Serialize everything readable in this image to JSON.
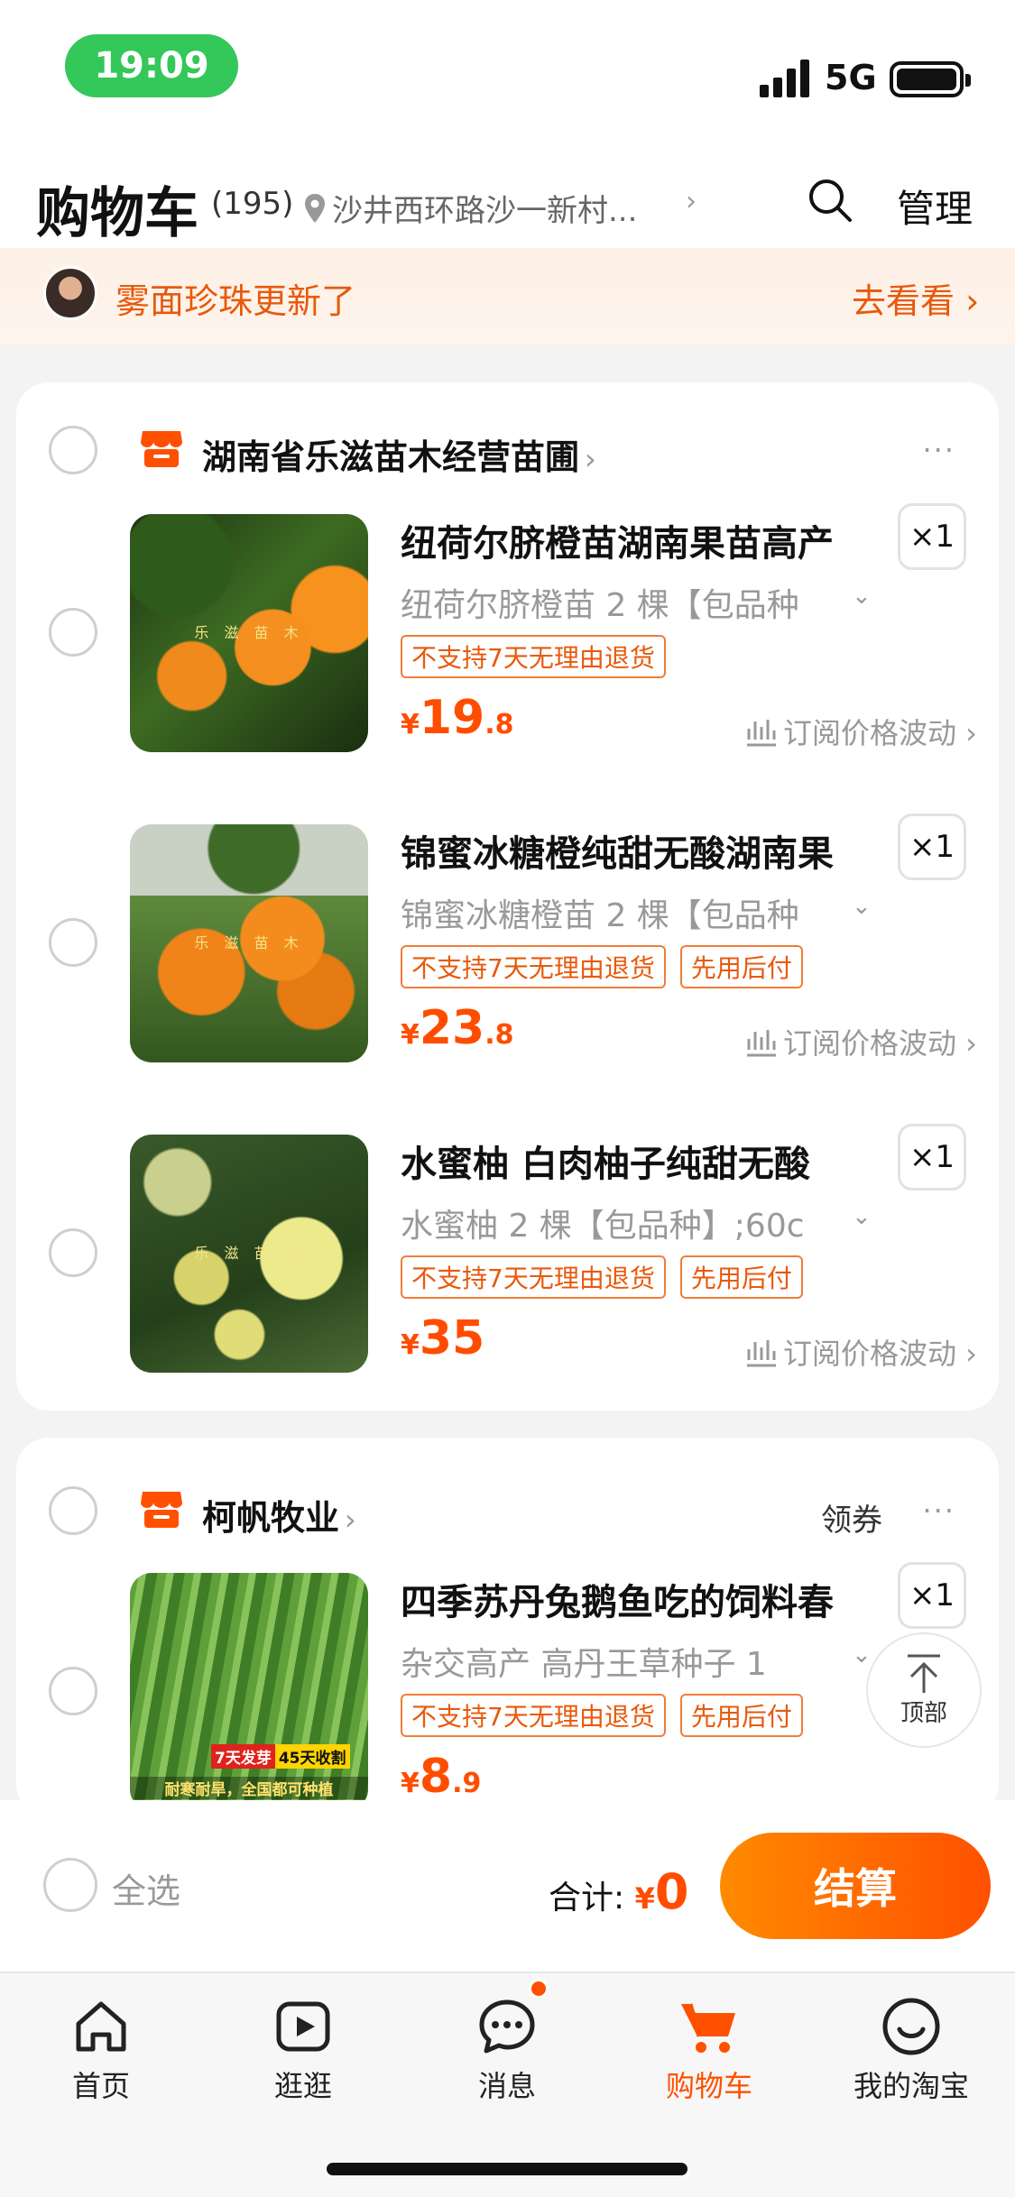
{
  "status_bar": {
    "time": "19:09",
    "network": "5G"
  },
  "header": {
    "title": "购物车",
    "count": "(195)",
    "location": "沙井西环路沙一新村...",
    "manage_label": "管理"
  },
  "notice": {
    "text": "雾面珍珠更新了",
    "link": "去看看 ›"
  },
  "shops": [
    {
      "name": "湖南省乐滋苗木经营苗圃",
      "items": [
        {
          "title": "纽荷尔脐橙苗湖南果苗高产",
          "qty": "×1",
          "spec": "纽荷尔脐橙苗 2 棵【包品种",
          "tags": [
            "不支持7天无理由退货"
          ],
          "price_currency": "¥",
          "price_int": "19",
          "price_dec": ".8",
          "watch": "订阅价格波动 ›",
          "watermark": "乐 滋 苗 木"
        },
        {
          "title": "锦蜜冰糖橙纯甜无酸湖南果",
          "qty": "×1",
          "spec": "锦蜜冰糖橙苗 2 棵【包品种",
          "tags": [
            "不支持7天无理由退货",
            "先用后付"
          ],
          "price_currency": "¥",
          "price_int": "23",
          "price_dec": ".8",
          "watch": "订阅价格波动 ›",
          "watermark": "乐 滋 苗 木"
        },
        {
          "title": "水蜜柚 白肉柚子纯甜无酸",
          "qty": "×1",
          "spec": "水蜜柚 2 棵【包品种】;60c",
          "tags": [
            "不支持7天无理由退货",
            "先用后付"
          ],
          "price_currency": "¥",
          "price_int": "35",
          "price_dec": "",
          "watch": "订阅价格波动 ›",
          "watermark": "乐 滋 苗 木"
        }
      ]
    },
    {
      "name": "柯帆牧业",
      "coupon_label": "领券",
      "items": [
        {
          "title": "四季苏丹兔鹅鱼吃的饲料春",
          "qty": "×1",
          "spec": "杂交高产 高丹王草种子 1",
          "tags": [
            "不支持7天无理由退货",
            "先用后付"
          ],
          "price_currency": "¥",
          "price_int": "8",
          "price_dec": ".9",
          "badge_left": "7天发芽",
          "badge_right": "45天收割",
          "caption": "耐寒耐旱，全国都可种植"
        }
      ]
    }
  ],
  "back_to_top_label": "顶部",
  "checkout": {
    "select_all": "全选",
    "total_label": "合计:",
    "total_currency": "¥",
    "total_amount": "0",
    "pay_label": "结算"
  },
  "tabs": [
    {
      "label": "首页",
      "icon": "home-icon"
    },
    {
      "label": "逛逛",
      "icon": "play-icon"
    },
    {
      "label": "消息",
      "icon": "chat-icon"
    },
    {
      "label": "购物车",
      "icon": "cart-icon"
    },
    {
      "label": "我的淘宝",
      "icon": "smile-icon"
    }
  ],
  "colors": {
    "accent": "#ff5000",
    "tag": "#e8590c",
    "status_pill": "#34c759"
  }
}
